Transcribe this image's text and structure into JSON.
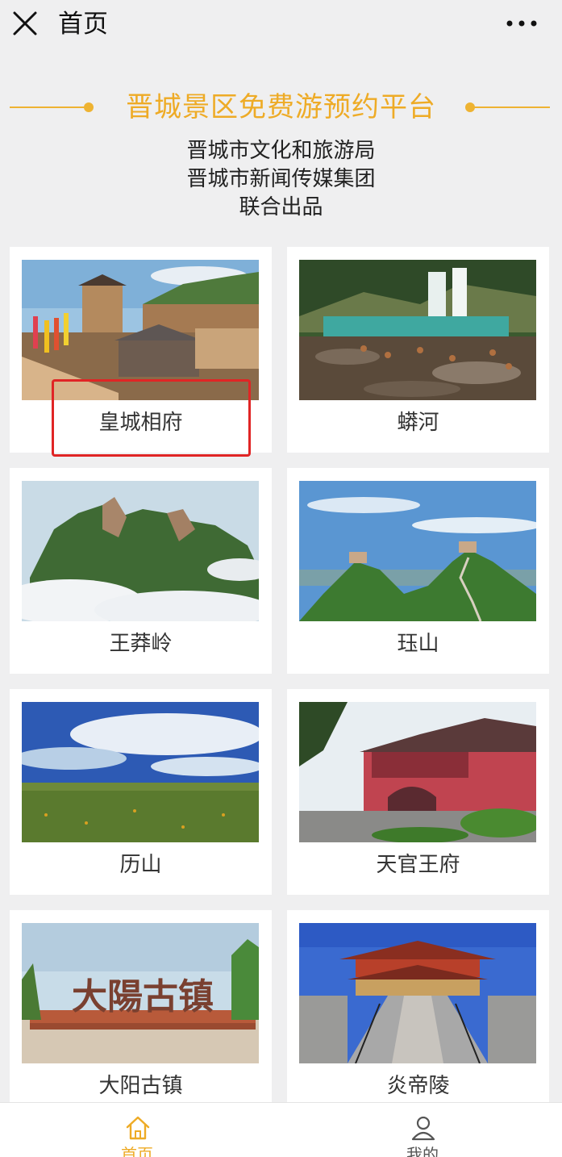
{
  "topbar": {
    "title": "首页"
  },
  "banner": {
    "title": "晋城景区免费游预约平台",
    "credits": [
      "晋城市文化和旅游局",
      "晋城市新闻传媒集团",
      "联合出品"
    ],
    "accent_color": "#eeab26"
  },
  "scenic_spots": [
    {
      "name": "皇城相府"
    },
    {
      "name": "蟒河"
    },
    {
      "name": "王莽岭"
    },
    {
      "name": "珏山"
    },
    {
      "name": "历山"
    },
    {
      "name": "天官王府"
    },
    {
      "name": "大阳古镇",
      "photo_sign_text": "大陽古镇"
    },
    {
      "name": "炎帝陵"
    }
  ],
  "highlight_color": "#e02525",
  "tabbar": {
    "home_label": "首页",
    "mine_label": "我的",
    "active_color": "#eeab26"
  }
}
